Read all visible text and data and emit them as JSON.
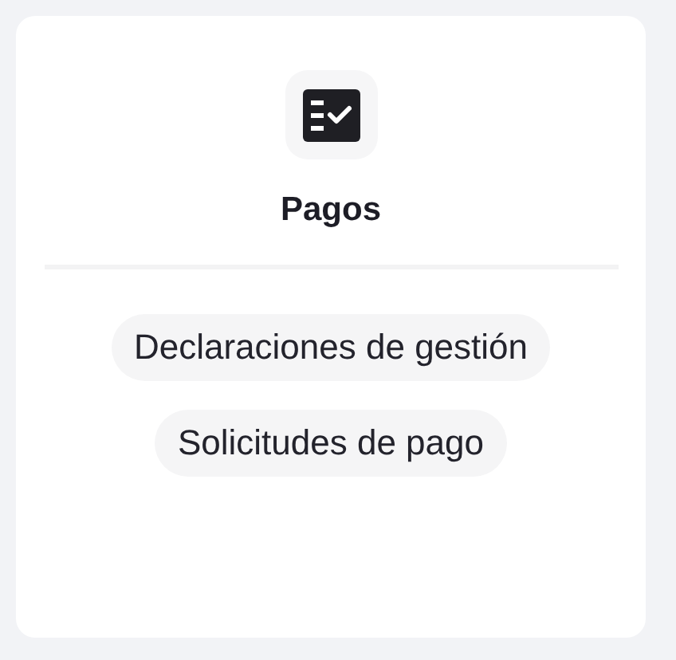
{
  "card": {
    "title": "Pagos",
    "links": [
      "Declaraciones de gestión",
      "Solicitudes de pago"
    ]
  }
}
